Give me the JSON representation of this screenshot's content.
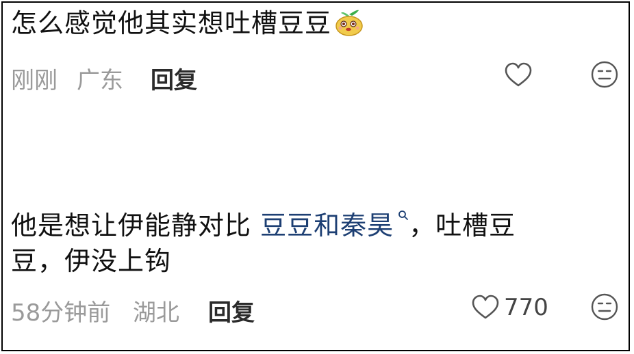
{
  "comments": [
    {
      "text": "怎么感觉他其实想吐槽豆豆",
      "time": "刚刚",
      "location": "广东",
      "reply_label": "回复",
      "like_count": ""
    },
    {
      "text_before": "他是想让伊能静对比 ",
      "link_text": "豆豆和秦昊",
      "text_after_line1": "，吐槽豆",
      "text_line2": "豆，伊没上钩",
      "time": "58分钟前",
      "location": "湖北",
      "reply_label": "回复",
      "like_count": "770"
    }
  ],
  "icons": {
    "like": "heart-outline-icon",
    "react": "neutral-face-icon",
    "emoji": "bean-sticker-emoji",
    "search": "search-icon"
  },
  "colors": {
    "link": "#1d3f73",
    "meta_text": "#9a9a9a",
    "reply_text": "#2b2b2b"
  }
}
